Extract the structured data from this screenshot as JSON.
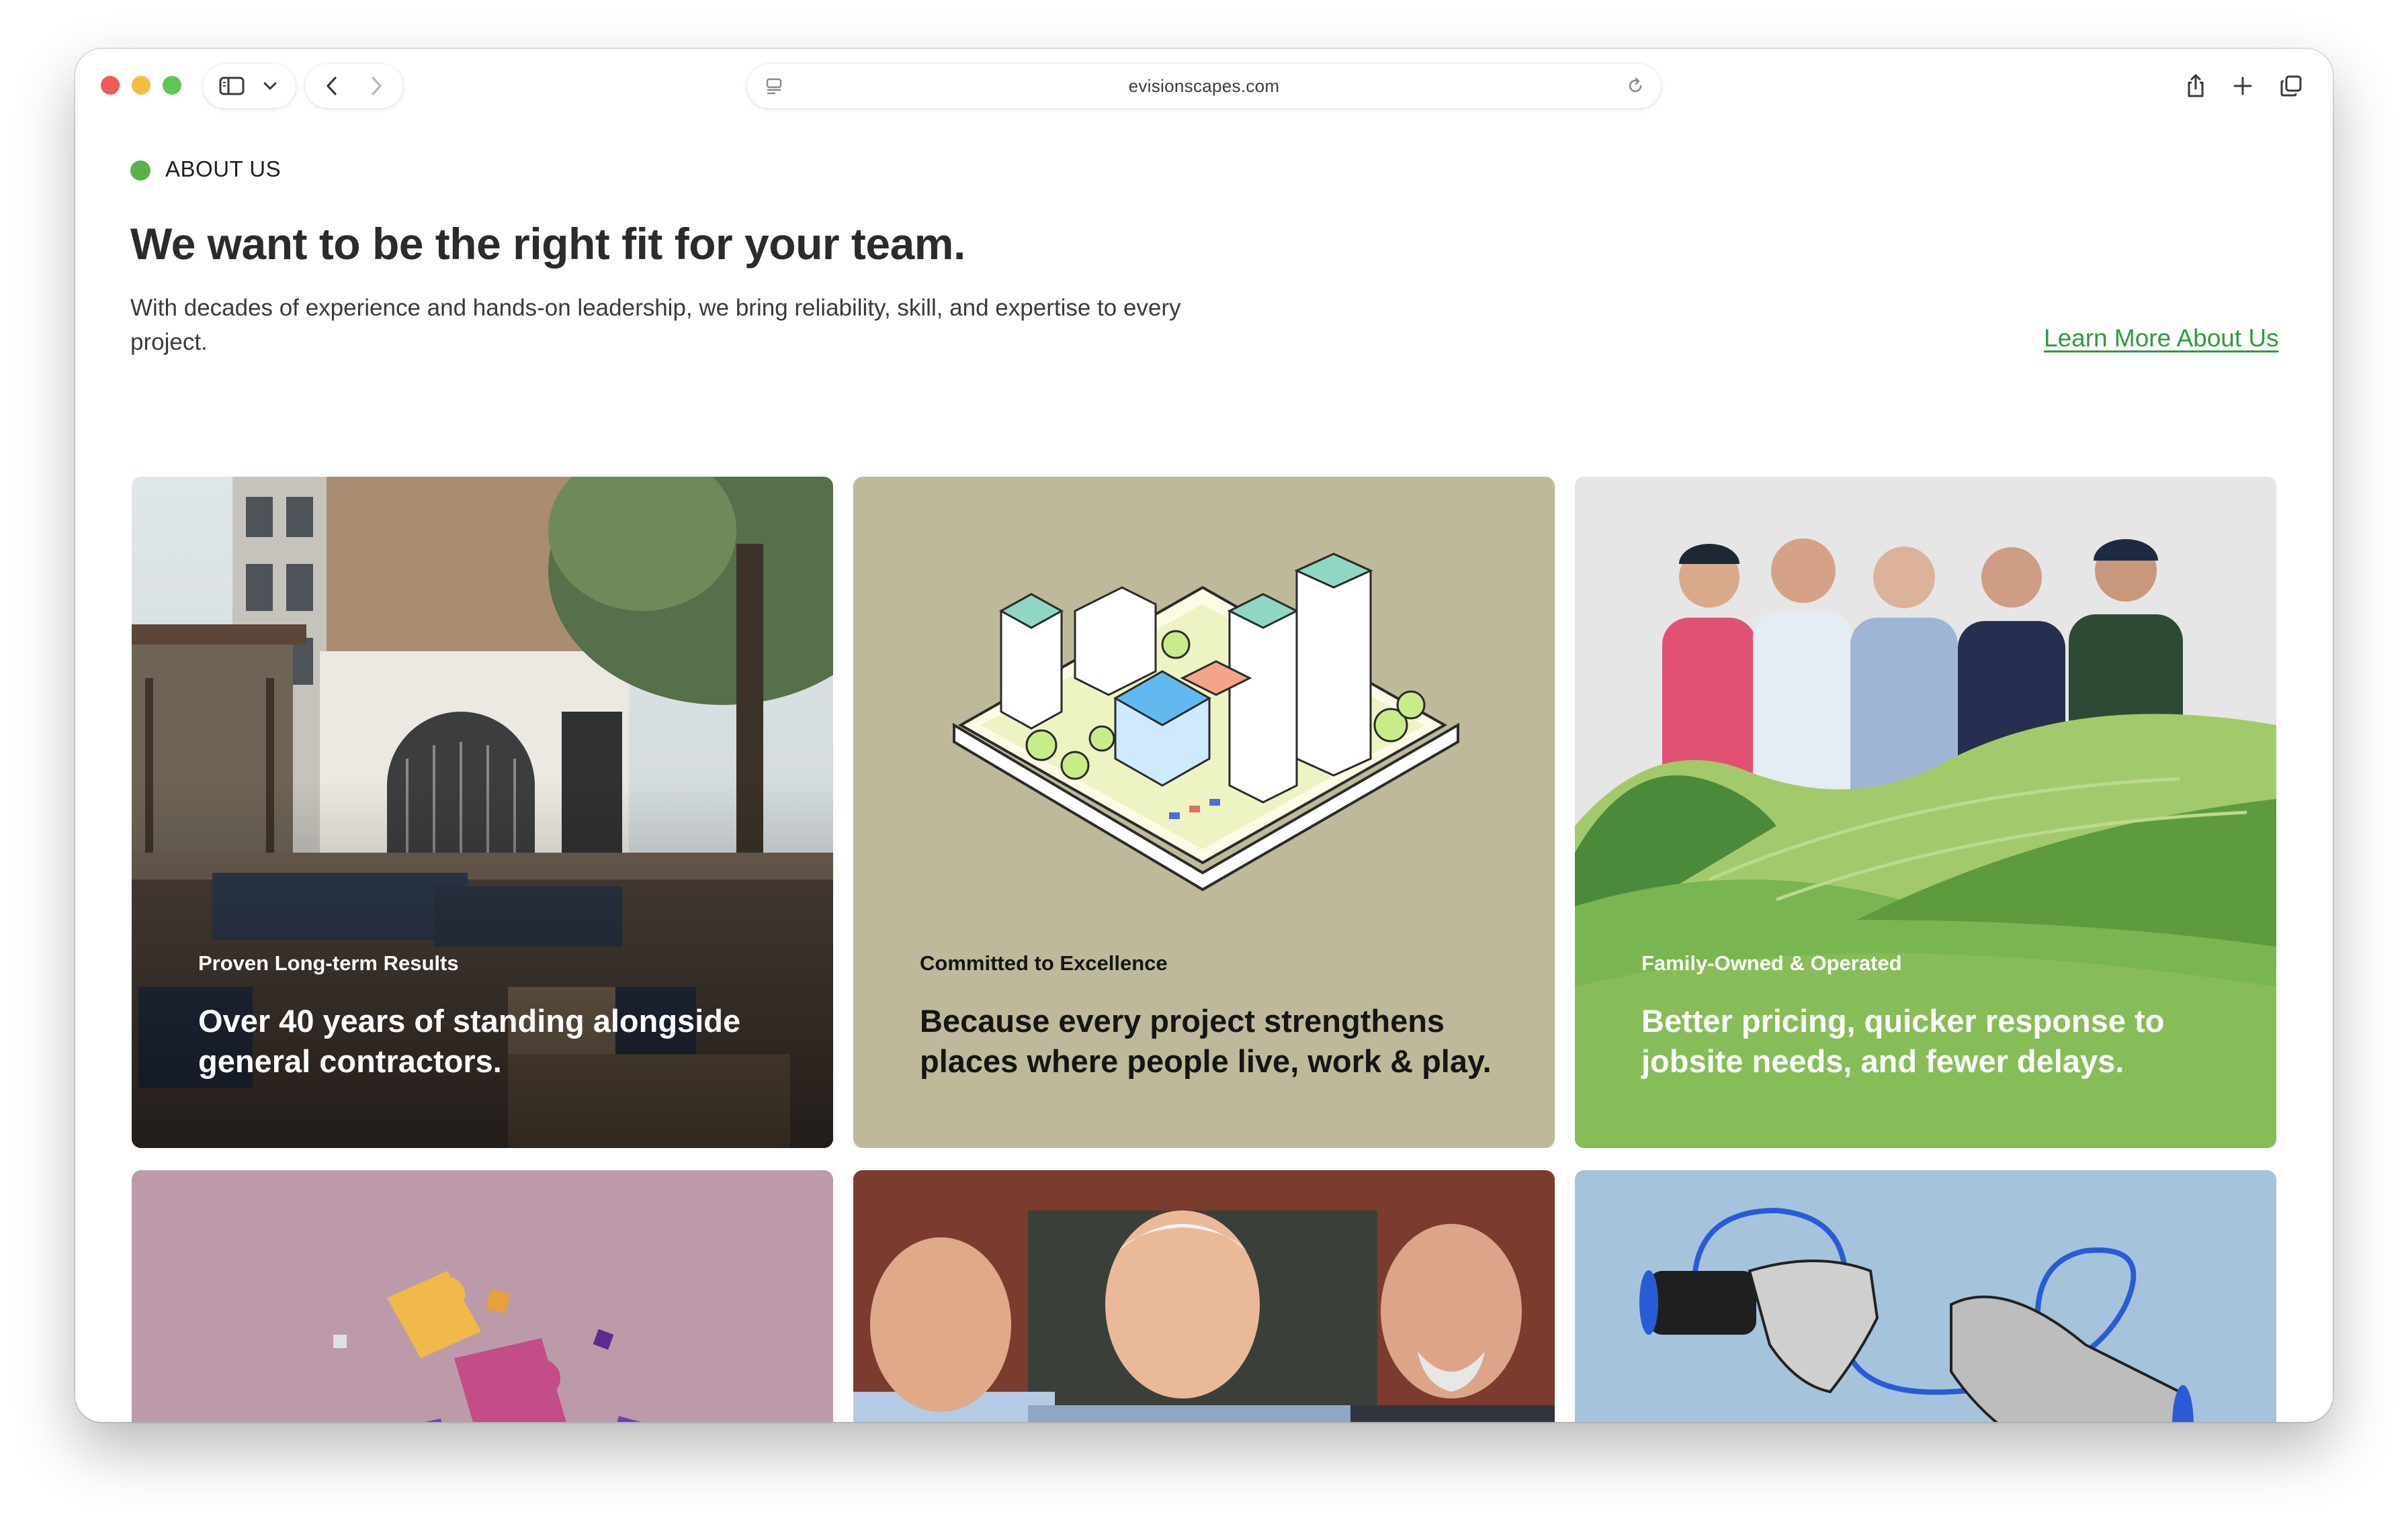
{
  "browser": {
    "url": "evisionscapes.com",
    "icons": {
      "sidebar": "sidebar-icon",
      "dropdown": "chevron-down-icon",
      "back": "chevron-left-icon",
      "forward": "chevron-right-icon",
      "reader": "page-summary-icon",
      "reload": "reload-icon",
      "share": "share-icon",
      "new_tab": "plus-icon",
      "tabs": "tab-overview-icon"
    }
  },
  "about": {
    "label": "ABOUT US",
    "headline": "We want to be the right fit for your team.",
    "subtext": "With decades of experience and hands-on leadership, we bring reliability, skill, and expertise to every project.",
    "cta": "Learn More About Us",
    "accent_color": "#5bb04a",
    "link_color": "#2f9a3a"
  },
  "cards": [
    {
      "eyebrow": "Proven Long-term Results",
      "title": "Over 40 years of standing alongside general contractors.",
      "background": "photo"
    },
    {
      "eyebrow": "Committed to Excellence",
      "title": "Because every project strengthens places where people live, work & play.",
      "background": "#bdb99a"
    },
    {
      "eyebrow": "Family-Owned & Operated",
      "title": "Better pricing, quicker response to jobsite needs, and fewer delays.",
      "background": "#7fb857"
    },
    {
      "background": "#bd9aaa",
      "illustration": "puzzle-pieces"
    },
    {
      "background": "photo",
      "illustration": "three-men-portrait"
    },
    {
      "background": "#a6c3dc",
      "illustration": "handshake"
    }
  ]
}
